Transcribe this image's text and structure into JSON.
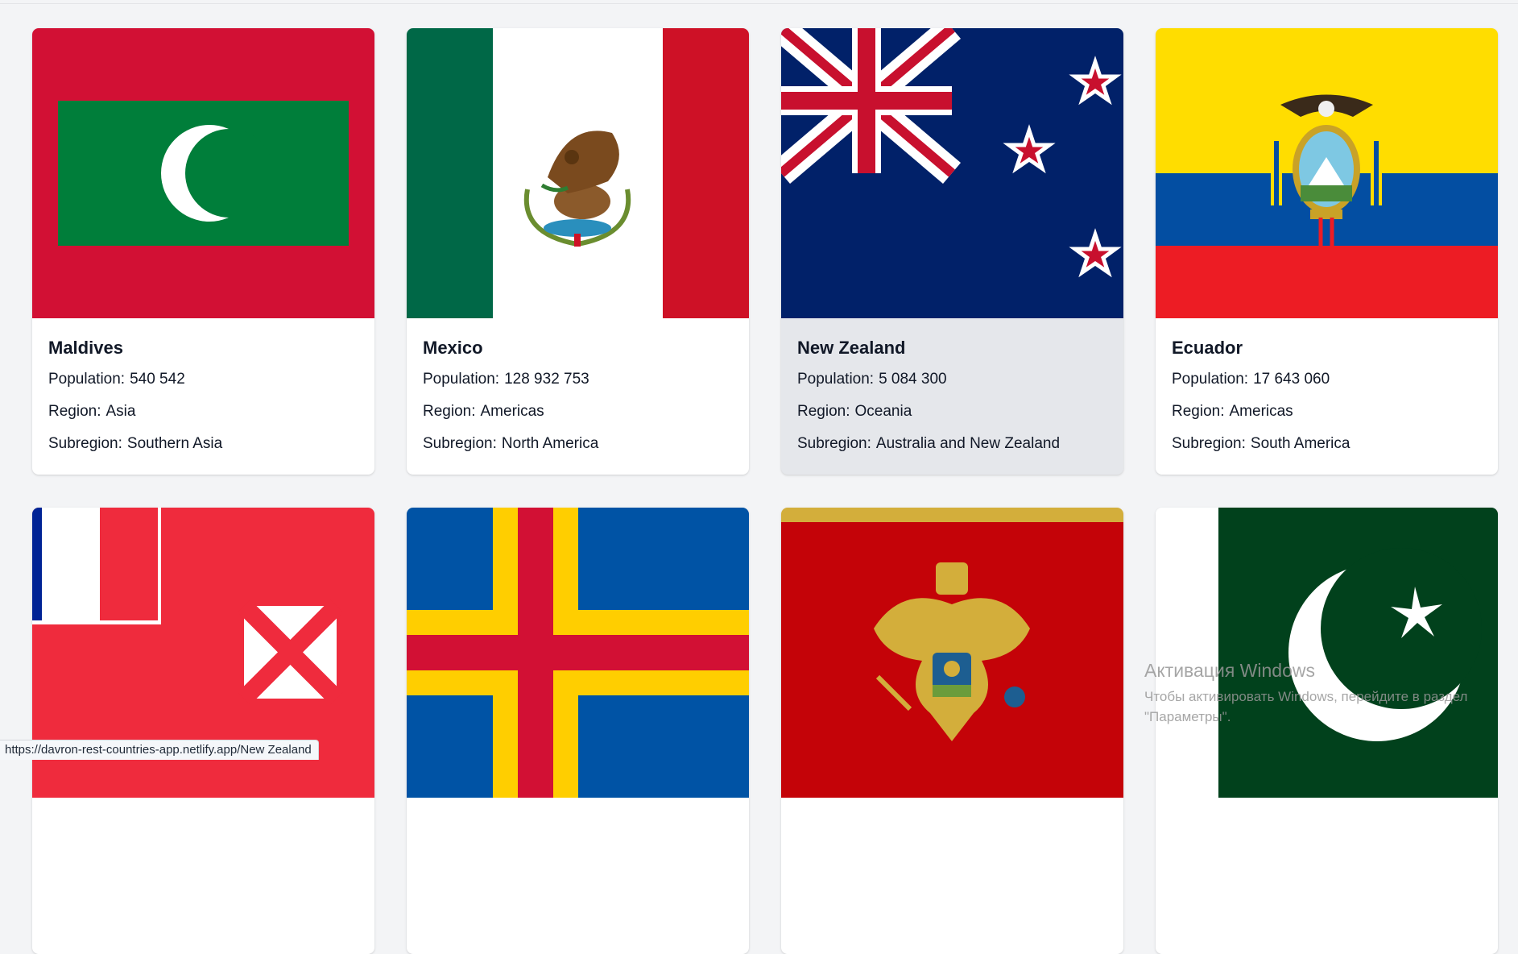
{
  "countries": [
    {
      "name": "Maldives",
      "population": "540 542",
      "region": "Asia",
      "subregion": "Southern Asia",
      "flag_icon": "maldives-flag"
    },
    {
      "name": "Mexico",
      "population": "128 932 753",
      "region": "Americas",
      "subregion": "North America",
      "flag_icon": "mexico-flag"
    },
    {
      "name": "New Zealand",
      "population": "5 084 300",
      "region": "Oceania",
      "subregion": "Australia and New Zealand",
      "flag_icon": "new-zealand-flag"
    },
    {
      "name": "Ecuador",
      "population": "17 643 060",
      "region": "Americas",
      "subregion": "South America",
      "flag_icon": "ecuador-flag"
    }
  ],
  "next_row_flags": [
    "wallis-and-futuna-flag",
    "aland-islands-flag",
    "montenegro-flag",
    "pakistan-flag"
  ],
  "labels": {
    "population": "Population:",
    "region": "Region:",
    "subregion": "Subregion:"
  },
  "status_bar": {
    "url": "https://davron-rest-countries-app.netlify.app/New Zealand"
  },
  "windows_activation": {
    "title": "Активация Windows",
    "line1": "Чтобы активировать Windows, перейдите в раздел",
    "line2": "\"Параметры\"."
  },
  "colors": {
    "background": "#f3f4f6",
    "card": "#ffffff",
    "card_hover": "#e5e7eb",
    "text": "#111827"
  }
}
